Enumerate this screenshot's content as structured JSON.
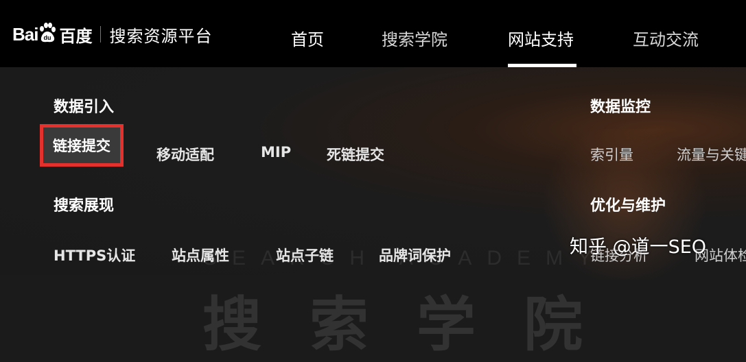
{
  "header": {
    "logo_text": "Bai",
    "logo_text2": "百度",
    "platform": "搜索资源平台",
    "nav": [
      "首页",
      "搜索学院",
      "网站支持",
      "互动交流"
    ],
    "active_nav": "网站支持"
  },
  "panel": {
    "groups": [
      {
        "title": "数据引入",
        "links": [
          "链接提交",
          "移动适配",
          "MIP",
          "死链提交"
        ]
      },
      {
        "title": "搜索展现",
        "links": [
          "HTTPS认证",
          "站点属性",
          "站点子链",
          "品牌词保护"
        ]
      },
      {
        "title": "数据监控",
        "links": [
          "索引量",
          "流量与关键"
        ]
      },
      {
        "title": "优化与维护",
        "links": [
          "链接分析",
          "网站体检"
        ]
      }
    ],
    "highlighted_link": "链接提交",
    "watermark_en": "SEARCH ACADEMY",
    "watermark_cn": "搜索学院"
  },
  "overlay": {
    "credit": "知乎 @道一SEO"
  },
  "colors": {
    "highlight_border": "#e5312d",
    "topbar": "#000000",
    "panel": "#1b1b1b"
  }
}
